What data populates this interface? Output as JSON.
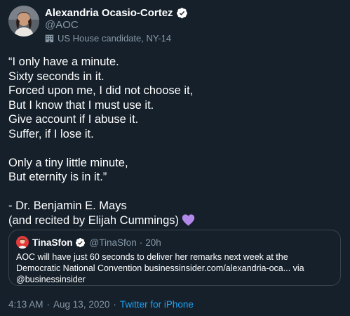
{
  "author": {
    "display_name": "Alexandria Ocasio-Cortez",
    "handle": "@AOC",
    "label": "US House candidate, NY-14",
    "label_icon": "building-icon",
    "verified": true
  },
  "tweet": {
    "lines": [
      "“I only have a minute.",
      "Sixty seconds in it.",
      "Forced upon me, I did not choose it,",
      "But I know that I must use it.",
      "Give account if I abuse it.",
      "Suffer, if I lose it.",
      "",
      "Only a tiny little minute,",
      "But eternity is in it.”",
      "",
      "- Dr. Benjamin E. Mays",
      "(and recited by Elijah Cummings)"
    ],
    "emoji": "purple-heart",
    "emoji_color": "#b388eb"
  },
  "quoted_tweet": {
    "display_name": "TinaSfon",
    "handle": "@TinaSfon",
    "dot": "·",
    "time": "20h",
    "verified": true,
    "lines": [
      "AOC will have just 60 seconds to deliver her remarks next week at the",
      "Democratic National Convention businessinsider.com/alexandria-oca... via",
      "@businessinsider"
    ]
  },
  "meta": {
    "time": "4:13 AM",
    "sep": "·",
    "date": "Aug 13, 2020",
    "source": "Twitter for iPhone"
  },
  "colors": {
    "background": "#15202b",
    "text": "#ffffff",
    "secondary": "#8899a6",
    "link": "#1da1f2",
    "border": "#38444d"
  }
}
